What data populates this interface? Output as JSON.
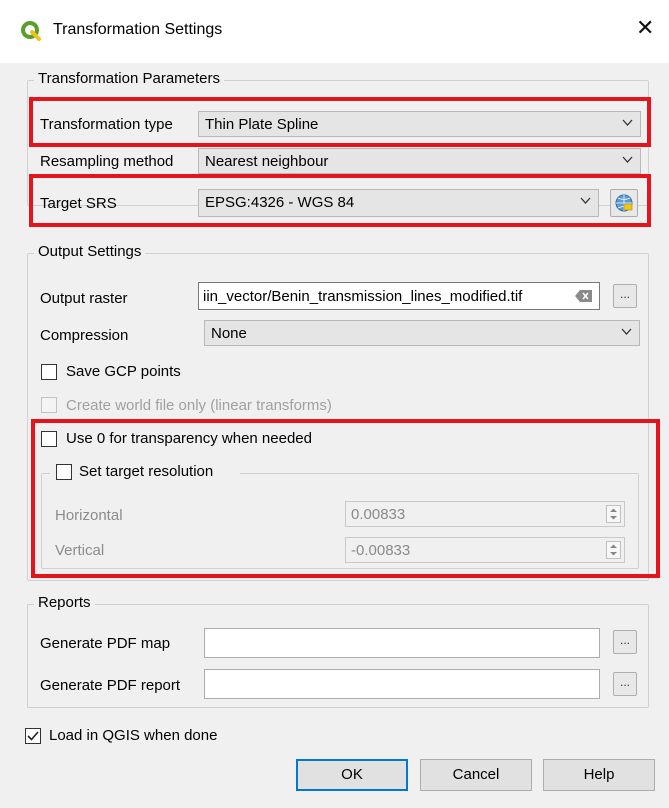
{
  "window": {
    "title": "Transformation Settings",
    "close_icon": "close-icon"
  },
  "transformation_parameters": {
    "legend": "Transformation Parameters",
    "transformation_type_label": "Transformation type",
    "transformation_type_value": "Thin Plate Spline",
    "resampling_label": "Resampling method",
    "resampling_value": "Nearest neighbour",
    "target_srs_label": "Target SRS",
    "target_srs_value": "EPSG:4326 - WGS 84"
  },
  "output_settings": {
    "legend": "Output Settings",
    "output_raster_label": "Output raster",
    "output_raster_value": "iin_vector/Benin_transmission_lines_modified.tif",
    "browse_label": "...",
    "compression_label": "Compression",
    "compression_value": "None",
    "save_gcp_label": "Save GCP points",
    "save_gcp_checked": false,
    "world_file_label": "Create world file only (linear transforms)",
    "world_file_checked": false,
    "use_zero_label": "Use 0 for transparency when needed",
    "use_zero_checked": false,
    "target_resolution_label": "Set target resolution",
    "target_resolution_checked": false,
    "horizontal_label": "Horizontal",
    "horizontal_value": "0.00833",
    "vertical_label": "Vertical",
    "vertical_value": "-0.00833"
  },
  "reports": {
    "legend": "Reports",
    "pdf_map_label": "Generate PDF map",
    "pdf_map_value": "",
    "pdf_report_label": "Generate PDF report",
    "pdf_report_value": "",
    "browse_label": "..."
  },
  "load_in_qgis": {
    "label": "Load in QGIS when done",
    "checked": true
  },
  "buttons": {
    "ok": "OK",
    "cancel": "Cancel",
    "help": "Help"
  },
  "colors": {
    "highlight": "#e3141b",
    "default_button_border": "#0078d7",
    "qgis_green": "#5a9e2e"
  }
}
